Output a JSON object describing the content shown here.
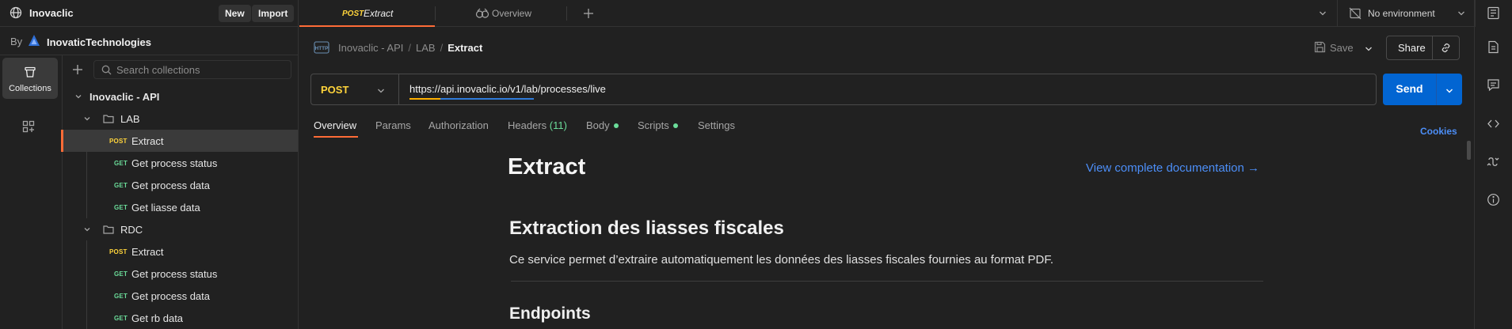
{
  "workspace": {
    "name": "Inovaclic",
    "new_label": "New",
    "import_label": "Import",
    "by_label": "By",
    "team_name": "InovaticTechnologies"
  },
  "rail": {
    "collections_label": "Collections"
  },
  "search": {
    "placeholder": "Search collections"
  },
  "tree": {
    "collection": "Inovaclic - API",
    "folders": [
      {
        "name": "LAB",
        "requests": [
          {
            "method": "POST",
            "name": "Extract"
          },
          {
            "method": "GET",
            "name": "Get process status"
          },
          {
            "method": "GET",
            "name": "Get process data"
          },
          {
            "method": "GET",
            "name": "Get liasse data"
          }
        ]
      },
      {
        "name": "RDC",
        "requests": [
          {
            "method": "POST",
            "name": "Extract"
          },
          {
            "method": "GET",
            "name": "Get process status"
          },
          {
            "method": "GET",
            "name": "Get process data"
          },
          {
            "method": "GET",
            "name": "Get rb data"
          }
        ]
      }
    ]
  },
  "tabs": {
    "active_method": "POST",
    "active_label": "Extract",
    "overview_label": "Overview"
  },
  "environment": {
    "label": "No environment"
  },
  "breadcrumb": {
    "items": [
      "Inovaclic - API",
      "LAB"
    ],
    "current": "Extract",
    "separator": "/"
  },
  "actions": {
    "save_label": "Save",
    "share_label": "Share"
  },
  "request": {
    "method": "POST",
    "url": "https://api.inovaclic.io/v1/lab/processes/live",
    "send_label": "Send"
  },
  "request_tabs": {
    "overview": "Overview",
    "params": "Params",
    "authorization": "Authorization",
    "headers": "Headers",
    "headers_count": "(11)",
    "body": "Body",
    "scripts": "Scripts",
    "settings": "Settings",
    "cookies": "Cookies"
  },
  "doc": {
    "title": "Extract",
    "link": "View complete documentation →",
    "heading": "Extraction des liasses fiscales",
    "paragraph": "Ce service permet d’extraire automatiquement les données des liasses fiscales fournies au format PDF.",
    "heading2": "Endpoints"
  },
  "colors": {
    "accent": "#ff6c37",
    "post": "#ffd43b",
    "get": "#6bdd9a",
    "send": "#0265d2",
    "link": "#4c8ef7"
  }
}
